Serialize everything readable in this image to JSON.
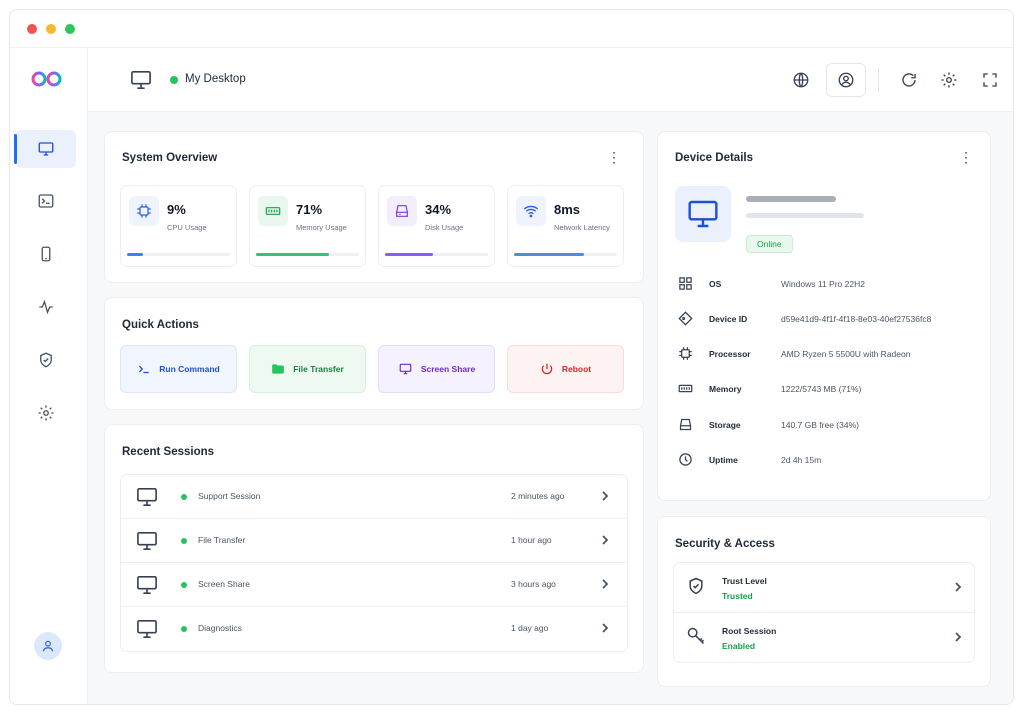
{
  "header": {
    "device_name": "My Desktop"
  },
  "system_overview": {
    "title": "System Overview",
    "stats": [
      {
        "value": "9%",
        "label": "CPU Usage",
        "fraction": 0.16,
        "color": "#3b82f6",
        "icon": "cpu-icon"
      },
      {
        "value": "71%",
        "label": "Memory Usage",
        "fraction": 0.71,
        "color": "#34c17a",
        "icon": "memory-icon"
      },
      {
        "value": "34%",
        "label": "Disk Usage",
        "fraction": 0.47,
        "color": "#8b5cf6",
        "icon": "disk-icon"
      },
      {
        "value": "8ms",
        "label": "Network Latency",
        "fraction": 0.68,
        "color": "#4a90e2",
        "icon": "wifi-icon"
      }
    ]
  },
  "quick_actions": {
    "title": "Quick Actions",
    "items": [
      {
        "label": "Run Command",
        "color": "#1d4ed8",
        "icon": "terminal-icon"
      },
      {
        "label": "File Transfer",
        "color": "#15803d",
        "icon": "folder-icon"
      },
      {
        "label": "Screen Share",
        "color": "#6d28d9",
        "icon": "monitor-icon"
      },
      {
        "label": "Reboot",
        "color": "#dc2626",
        "icon": "power-icon"
      }
    ]
  },
  "recent_sessions": {
    "title": "Recent Sessions",
    "rows": [
      {
        "name": "Support Session",
        "time": "2 minutes ago"
      },
      {
        "name": "File Transfer",
        "time": "1 hour ago"
      },
      {
        "name": "Screen Share",
        "time": "3 hours ago"
      },
      {
        "name": "Diagnostics",
        "time": "1 day ago"
      }
    ]
  },
  "device_details": {
    "title": "Device Details",
    "status": "Online",
    "rows": [
      {
        "key": "OS",
        "value": "Windows 11 Pro 22H2",
        "icon": "grid-icon"
      },
      {
        "key": "Device ID",
        "value": "d59e41d9-4f1f-4f18-8e03-40ef27536fc8",
        "icon": "tag-icon"
      },
      {
        "key": "Processor",
        "value": "AMD Ryzen 5 5500U with Radeon",
        "icon": "cpu-icon"
      },
      {
        "key": "Memory",
        "value": "1222/5743 MB (71%)",
        "icon": "memory-icon"
      },
      {
        "key": "Storage",
        "value": "140.7 GB free (34%)",
        "icon": "storage-icon"
      },
      {
        "key": "Uptime",
        "value": "2d 4h 15m",
        "icon": "clock-icon"
      }
    ]
  },
  "security": {
    "title": "Security & Access",
    "rows": [
      {
        "title": "Trust Level",
        "status": "Trusted",
        "icon": "shield-icon"
      },
      {
        "title": "Root Session",
        "status": "Enabled",
        "icon": "key-icon"
      }
    ]
  }
}
